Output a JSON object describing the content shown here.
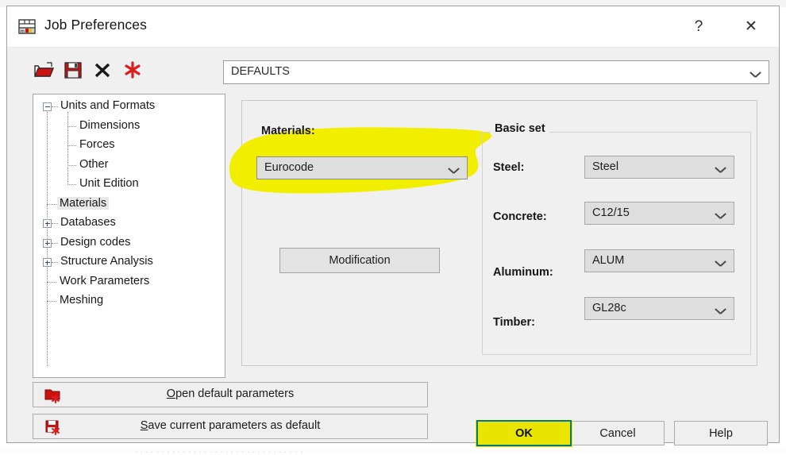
{
  "window": {
    "title": "Job Preferences",
    "app_icon": "table-grid-icon",
    "help_button": "?",
    "close_button": "✕"
  },
  "toolbar": {
    "icons": [
      {
        "name": "open-folder-icon",
        "tooltip": "Open"
      },
      {
        "name": "save-floppy-icon",
        "tooltip": "Save"
      },
      {
        "name": "delete-x-icon",
        "tooltip": "Delete"
      },
      {
        "name": "new-asterisk-icon",
        "tooltip": "New"
      }
    ],
    "profile_combo": {
      "value": "DEFAULTS",
      "chevron": "chevron-down-icon"
    }
  },
  "tree": {
    "items": [
      {
        "label": "Units and Formats",
        "level": 0,
        "expander": "minus",
        "selected": false
      },
      {
        "label": "Dimensions",
        "level": 1,
        "expander": "none",
        "selected": false
      },
      {
        "label": "Forces",
        "level": 1,
        "expander": "none",
        "selected": false
      },
      {
        "label": "Other",
        "level": 1,
        "expander": "none",
        "selected": false
      },
      {
        "label": "Unit Edition",
        "level": 1,
        "expander": "none",
        "selected": false
      },
      {
        "label": "Materials",
        "level": 0,
        "expander": "none",
        "selected": true
      },
      {
        "label": "Databases",
        "level": 0,
        "expander": "plus",
        "selected": false
      },
      {
        "label": "Design codes",
        "level": 0,
        "expander": "plus",
        "selected": false
      },
      {
        "label": "Structure Analysis",
        "level": 0,
        "expander": "plus",
        "selected": false
      },
      {
        "label": "Work Parameters",
        "level": 0,
        "expander": "none",
        "selected": false
      },
      {
        "label": "Meshing",
        "level": 0,
        "expander": "none",
        "selected": false
      }
    ]
  },
  "main": {
    "materials_label": "Materials:",
    "materials_combo": {
      "value": "Eurocode",
      "chevron": "chevron-down-icon"
    },
    "modification_button": "Modification",
    "basic_set": {
      "title": "Basic set",
      "rows": [
        {
          "label": "Steel:",
          "value": "Steel",
          "chevron": "chevron-down-icon"
        },
        {
          "label": "Concrete:",
          "value": "C12/15",
          "chevron": "chevron-down-icon"
        },
        {
          "label": "Aluminum:",
          "value": "ALUM",
          "chevron": "chevron-down-icon"
        },
        {
          "label": "Timber:",
          "value": "GL28c",
          "chevron": "chevron-down-icon"
        }
      ]
    }
  },
  "bottom": {
    "open_defaults": {
      "accel": "O",
      "rest": "pen default parameters",
      "icon": "open-folder-asterisk-icon"
    },
    "save_defaults": {
      "accel": "S",
      "rest": "ave current parameters as default",
      "icon": "save-floppy-asterisk-icon"
    },
    "ok": "OK",
    "cancel": "Cancel",
    "help": "Help"
  },
  "annotations": {
    "highlight_color": "#f2ee00",
    "ok_rect_color": "#0b7a18",
    "focus_color": "#0078d7",
    "marker_targets": [
      "materials-combo",
      "ok-button"
    ]
  }
}
